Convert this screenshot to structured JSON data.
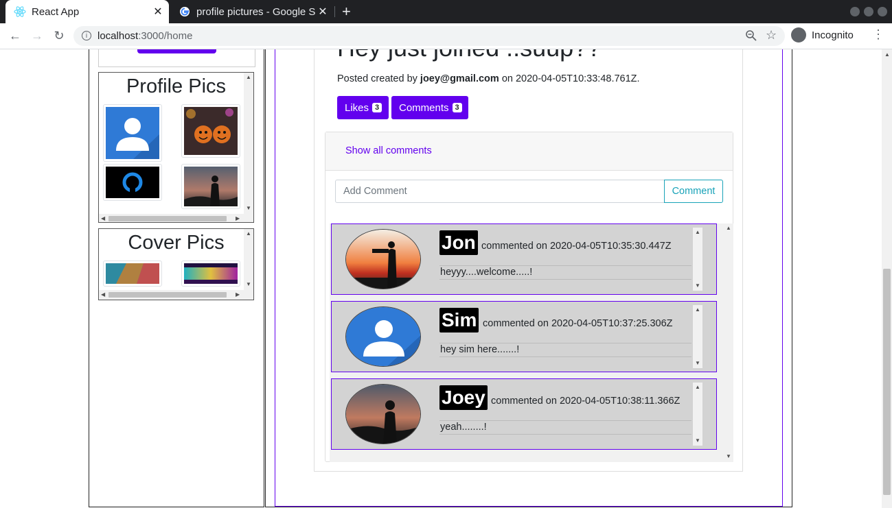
{
  "browser": {
    "tabs": [
      {
        "title": "React App",
        "active": true
      },
      {
        "title": "profile pictures - Google S",
        "active": false
      }
    ],
    "url_host": "localhost",
    "url_path": ":3000/home",
    "incognito_label": "Incognito"
  },
  "sidebar": {
    "profile_pics_title": "Profile Pics",
    "cover_pics_title": "Cover Pics"
  },
  "post": {
    "title": "Hey just joined ..suup??",
    "meta_prefix": "Posted created by",
    "author": "joey@gmail.com",
    "meta_on": "on 2020-04-05T10:33:48.761Z.",
    "likes_label": "Likes",
    "likes_count": "3",
    "comments_label": "Comments",
    "comments_count": "3"
  },
  "comments_section": {
    "show_all_label": "Show all comments",
    "add_placeholder": "Add Comment",
    "comment_button": "Comment",
    "items": [
      {
        "name": "Jon",
        "meta": "commented on 2020-04-05T10:35:30.447Z",
        "text": "heyyy....welcome.....!"
      },
      {
        "name": "Sim",
        "meta": "commented on 2020-04-05T10:37:25.306Z",
        "text": "hey sim here.......!"
      },
      {
        "name": "Joey",
        "meta": "commented on 2020-04-05T10:38:11.366Z",
        "text": "yeah........!"
      }
    ]
  },
  "colors": {
    "accent": "#6200ee",
    "info": "#17a2b8",
    "comment_bg": "#d3d3d3"
  }
}
